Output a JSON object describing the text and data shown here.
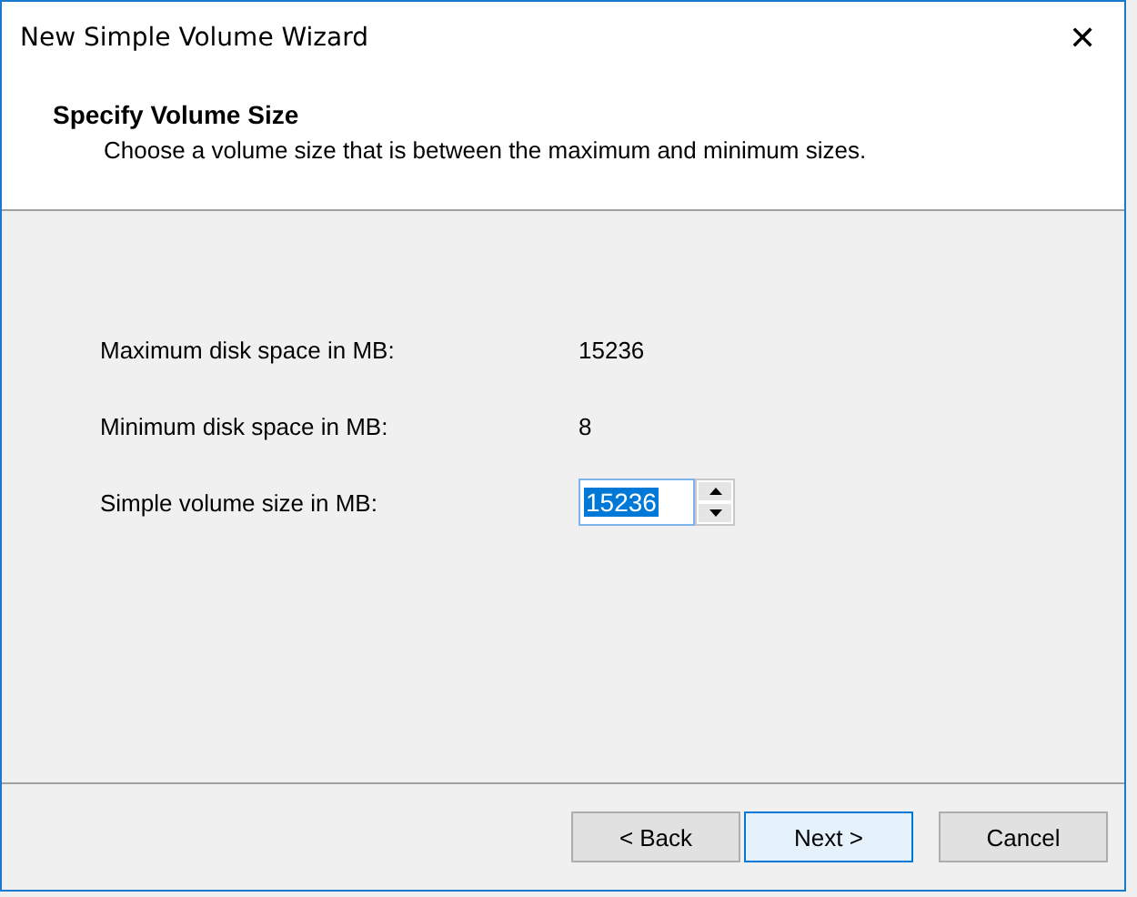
{
  "window": {
    "title": "New Simple Volume Wizard",
    "close": "✕"
  },
  "header": {
    "title": "Specify Volume Size",
    "subtitle": "Choose a volume size that is between the maximum and minimum sizes."
  },
  "fields": [
    {
      "kind": "text",
      "label": "Maximum disk space in MB:",
      "value": "15236"
    },
    {
      "kind": "text",
      "label": "Minimum disk space in MB:",
      "value": "8"
    },
    {
      "kind": "spin",
      "label": "Simple volume size in MB:",
      "value": "15236",
      "value_selected": true
    }
  ],
  "buttons": [
    {
      "label": "< Back",
      "default": false
    },
    {
      "label": "Next >",
      "default": true
    },
    {
      "label": "Cancel",
      "default": false
    }
  ]
}
